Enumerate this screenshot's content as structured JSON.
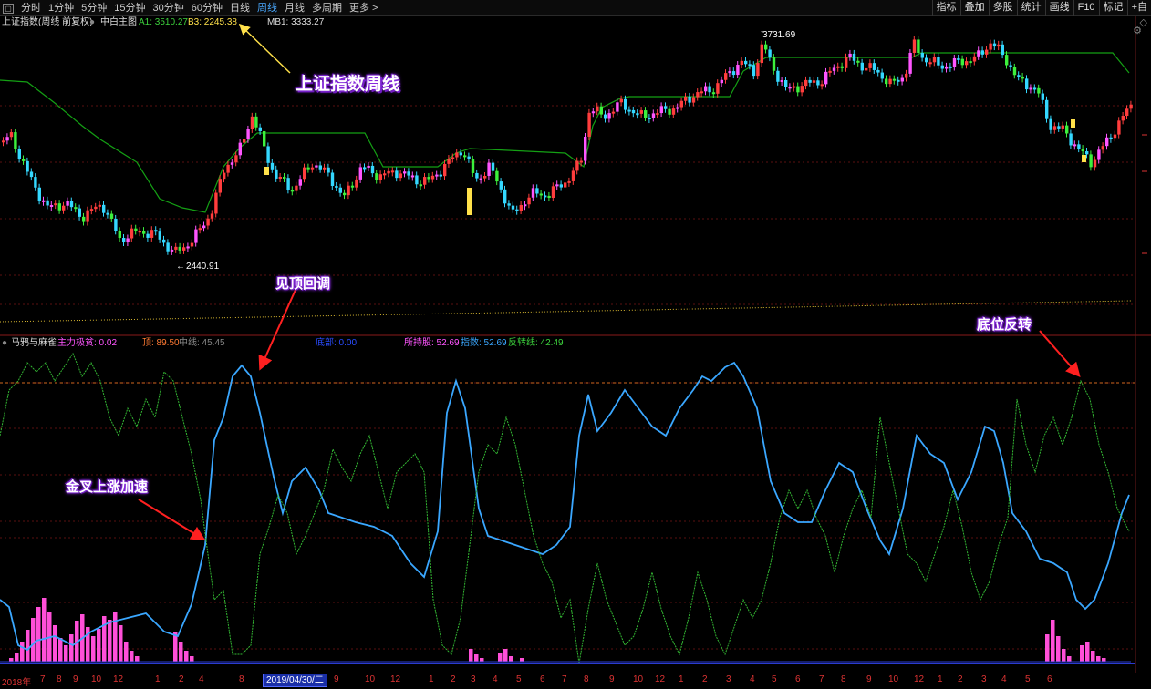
{
  "toolbar": {
    "tabs": [
      "分时",
      "1分钟",
      "5分钟",
      "15分钟",
      "30分钟",
      "60分钟",
      "日线",
      "周线",
      "月线",
      "多周期",
      "更多 >"
    ],
    "active_tab": "周线",
    "right_buttons": [
      "指标",
      "叠加",
      "多股",
      "统计",
      "画线",
      "F10",
      "标记",
      "+自"
    ]
  },
  "main_legend": {
    "index_name": "上证指数(周线 前复权)",
    "indicator": "中白主图",
    "a1_label": "A1: 3510.27",
    "b3_label": "B3: 2245.38",
    "mb1_label": "MB1: 3333.27"
  },
  "sub_legend": {
    "name": "马鸦与麻雀",
    "fund_label": "主力极贫: 0.02",
    "top_label": "顶: 89.50",
    "mid_label": "中线: 45.45",
    "hidden_label": "底部: 0.00",
    "hold_label": "所持股: 52.69",
    "index_label": "指数: 52.69",
    "reverse_label": "反转线: 42.49"
  },
  "annotations": {
    "weekly": "上证指数周线",
    "top": "见顶回调",
    "golden": "金叉上涨加速",
    "bottom": "底位反转"
  },
  "price_labels": {
    "high": "3731.69",
    "low": "2440.91"
  },
  "xaxis": {
    "date_highlight": "2019/04/30/二",
    "ticks": [
      "2018年",
      "7",
      "8",
      "9",
      "10",
      "12",
      "1",
      "2",
      "4",
      "8",
      "9",
      "10",
      "12",
      "1",
      "2",
      "3",
      "4",
      "5",
      "6",
      "7",
      "8",
      "9",
      "10",
      "12",
      "1",
      "2",
      "3",
      "4",
      "5",
      "6",
      "7",
      "8",
      "9",
      "10",
      "12",
      "1",
      "2",
      "3",
      "4",
      "5",
      "6"
    ]
  },
  "colors": {
    "up": "#ff3d3d",
    "down": "#34d8ff",
    "up_alt": "#ff55ff",
    "down_alt": "#3cf03c",
    "trend_line": "#14a014",
    "osc_blue": "#3aa7ff",
    "osc_green": "#33b833",
    "hist": "#ff4fd8"
  }
}
